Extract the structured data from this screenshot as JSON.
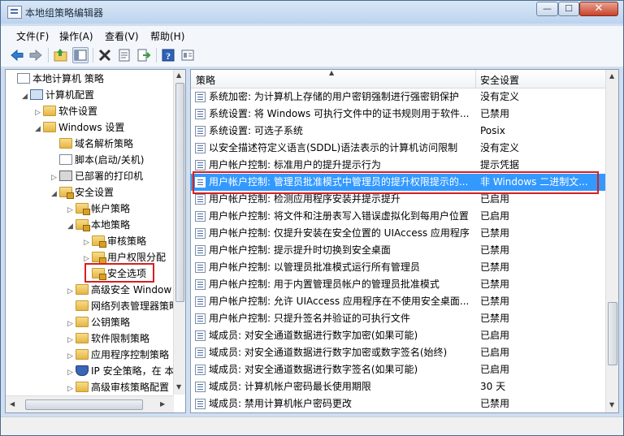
{
  "window": {
    "title": "本地组策略编辑器",
    "min_glyph": "—",
    "max_glyph": "☐",
    "close_glyph": "✕"
  },
  "menu": [
    "文件(F)",
    "操作(A)",
    "查看(V)",
    "帮助(H)"
  ],
  "toolbar_icons": [
    "back-icon",
    "forward-icon",
    "up-folder-icon",
    "show-hide-tree-icon",
    "delete-icon",
    "properties-icon",
    "export-icon",
    "help-icon",
    "view-icon"
  ],
  "tree": [
    {
      "label": "本地计算机 策略",
      "icon": "doc"
    },
    {
      "label": "计算机配置",
      "icon": "pc",
      "arrow": "◢"
    },
    {
      "label": "软件设置",
      "icon": "folder",
      "arrow": "▷"
    },
    {
      "label": "Windows 设置",
      "icon": "folder",
      "arrow": "◢"
    },
    {
      "label": "域名解析策略",
      "icon": "folder"
    },
    {
      "label": "脚本(启动/关机)",
      "icon": "doc"
    },
    {
      "label": "已部署的打印机",
      "icon": "prn",
      "arrow": "▷"
    },
    {
      "label": "安全设置",
      "icon": "lock",
      "arrow": "◢"
    },
    {
      "label": "帐户策略",
      "icon": "folder lock",
      "arrow": "▷"
    },
    {
      "label": "本地策略",
      "icon": "folder lock",
      "arrow": "◢"
    },
    {
      "label": "审核策略",
      "icon": "folder lock",
      "arrow": "▷"
    },
    {
      "label": "用户权限分配",
      "icon": "folder lock",
      "arrow": "▷"
    },
    {
      "label": "安全选项",
      "icon": "folder lock"
    },
    {
      "label": "高级安全 Window",
      "icon": "folder",
      "arrow": "▷"
    },
    {
      "label": "网络列表管理器策略",
      "icon": "folder"
    },
    {
      "label": "公钥策略",
      "icon": "folder",
      "arrow": "▷"
    },
    {
      "label": "软件限制策略",
      "icon": "folder",
      "arrow": "▷"
    },
    {
      "label": "应用程序控制策略",
      "icon": "folder",
      "arrow": "▷"
    },
    {
      "label": "IP 安全策略，在 本",
      "icon": "shield",
      "arrow": "▷"
    },
    {
      "label": "高级审核策略配置",
      "icon": "folder",
      "arrow": "▷"
    }
  ],
  "list": {
    "col_policy": "策略",
    "col_setting": "安全设置",
    "rows": [
      {
        "policy": "系统加密: 为计算机上存储的用户密钥强制进行强密钥保护",
        "setting": "没有定义"
      },
      {
        "policy": "系统设置: 将 Windows 可执行文件中的证书规则用于软件...",
        "setting": "已禁用"
      },
      {
        "policy": "系统设置: 可选子系统",
        "setting": "Posix"
      },
      {
        "policy": "以安全描述符定义语言(SDDL)语法表示的计算机访问限制",
        "setting": "没有定义"
      },
      {
        "policy": "用户帐户控制: 标准用户的提升提示行为",
        "setting": "提示凭据"
      },
      {
        "policy": "用户帐户控制: 管理员批准模式中管理员的提升权限提示的...",
        "setting": "非 Windows 二进制文..."
      },
      {
        "policy": "用户帐户控制: 检测应用程序安装并提示提升",
        "setting": "已启用"
      },
      {
        "policy": "用户帐户控制: 将文件和注册表写入错误虚拟化到每用户位置",
        "setting": "已启用"
      },
      {
        "policy": "用户帐户控制: 仅提升安装在安全位置的 UIAccess 应用程序",
        "setting": "已禁用"
      },
      {
        "policy": "用户帐户控制: 提示提升时切换到安全桌面",
        "setting": "已禁用"
      },
      {
        "policy": "用户帐户控制: 以管理员批准模式运行所有管理员",
        "setting": "已禁用"
      },
      {
        "policy": "用户帐户控制: 用于内置管理员帐户的管理员批准模式",
        "setting": "已禁用"
      },
      {
        "policy": "用户帐户控制: 允许 UIAccess 应用程序在不使用安全桌面...",
        "setting": "已禁用"
      },
      {
        "policy": "用户帐户控制: 只提升签名并验证的可执行文件",
        "setting": "已禁用"
      },
      {
        "policy": "域成员: 对安全通道数据进行数字加密(如果可能)",
        "setting": "已启用"
      },
      {
        "policy": "域成员: 对安全通道数据进行数字加密或数字签名(始终)",
        "setting": "已启用"
      },
      {
        "policy": "域成员: 对安全通道数据进行数字签名(如果可能)",
        "setting": "已启用"
      },
      {
        "policy": "域成员: 计算机帐户密码最长使用期限",
        "setting": "30 天"
      },
      {
        "policy": "域成员: 禁用计算机帐户密码更改",
        "setting": "已禁用"
      }
    ]
  }
}
